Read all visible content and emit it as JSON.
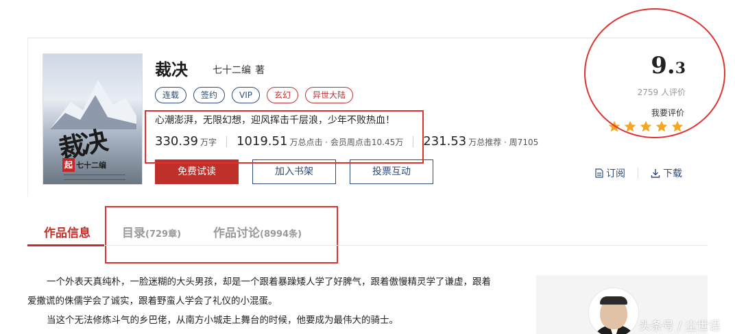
{
  "book": {
    "title": "裁决",
    "author": "七十二编",
    "author_suffix": "著",
    "tags": [
      {
        "label": "连载",
        "style": "blue"
      },
      {
        "label": "签约",
        "style": "blue"
      },
      {
        "label": "VIP",
        "style": "blue"
      },
      {
        "label": "玄幻",
        "style": "red"
      },
      {
        "label": "异世大陆",
        "style": "red"
      }
    ],
    "intro": "心潮澎湃，无限幻想，迎风挥击千层浪，少年不败热血！",
    "stats": {
      "words_value": "330.39",
      "words_unit": "万字",
      "clicks_value": "1019.51",
      "clicks_unit": "万总点击 · 会员周点击10.45万",
      "recs_value": "231.53",
      "recs_unit": "万总推荐 · 周7105"
    },
    "cover": {
      "calligraphy": "裁决",
      "seal": "起",
      "author_tag": "七十二编"
    }
  },
  "actions": {
    "read": "免费试读",
    "shelf": "加入书架",
    "vote": "投票互动",
    "subscribe": "订阅",
    "download": "下载"
  },
  "rating": {
    "score_int": "9.",
    "score_dec": "3",
    "count": "2759",
    "count_unit": "人评价",
    "rate_me": "我要评价",
    "stars_filled": 5,
    "stars_total": 5,
    "star_color": "#f5a623"
  },
  "tabs": [
    {
      "label": "作品信息",
      "sub": "",
      "active": true
    },
    {
      "label": "目录",
      "sub": "(729章)",
      "active": false
    },
    {
      "label": "作品讨论",
      "sub": "(8994条)",
      "active": false
    }
  ],
  "description": {
    "p1": "一个外表天真纯朴，一脸迷糊的大头男孩，却是一个跟着暴躁矮人学了好脾气，跟着傲慢精灵学了谦虚，跟着",
    "p1b": "爱撒谎的侏儒学会了诚实，跟着野蛮人学会了礼仪的小混蛋。",
    "p2": "当这个无法修炼斗气的乡巴佬，从南方小城走上舞台的时候，他要成为最伟大的骑士。"
  },
  "watermark": "头条号 / 尘世语",
  "colors": {
    "accent_red": "#c0302b",
    "link_blue": "#2c4a7a",
    "annotation_red": "#e0312f"
  }
}
